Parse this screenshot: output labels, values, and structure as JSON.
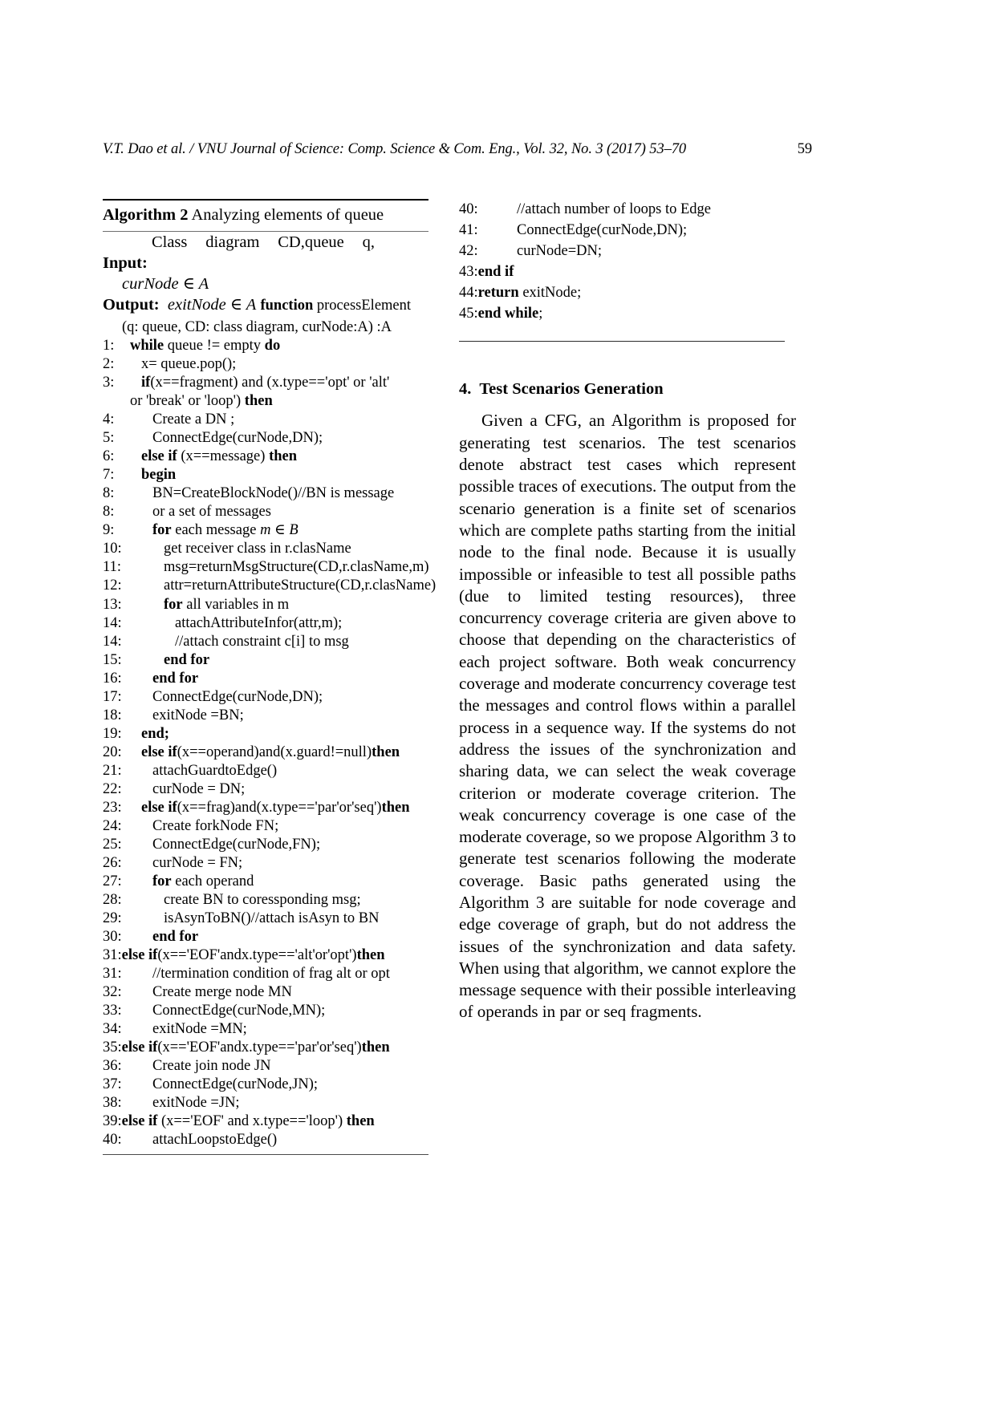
{
  "running_head": {
    "citation": "V.T. Dao et al. / VNU Journal of Science: Comp. Science & Com. Eng., Vol. 32, No. 3 (2017) 53–70",
    "page_number": "59"
  },
  "algorithm": {
    "label": "Algorithm 2",
    "title": "Analyzing elements of queue",
    "input_label": "Input:",
    "input_value_parts": [
      "Class",
      "diagram",
      "CD,queue",
      "q,"
    ],
    "input_value_line2": "curNode ∈ A",
    "output_label": "Output:",
    "output_value": "exitNode ∈ A",
    "output_function_kw": "function",
    "output_function_name": "processElement",
    "signature": "(q: queue, CD: class diagram, curNode:A) :A",
    "lines": [
      {
        "num": "1:",
        "indent": 0,
        "segments": [
          {
            "t": "while ",
            "s": "kw"
          },
          {
            "t": "queue != empty ",
            "s": ""
          },
          {
            "t": "do",
            "s": "kw"
          }
        ]
      },
      {
        "num": "2:",
        "indent": 1,
        "segments": [
          {
            "t": "x= queue.pop();",
            "s": ""
          }
        ]
      },
      {
        "num": "3:",
        "indent": 1,
        "segments": [
          {
            "t": "if",
            "s": "kw"
          },
          {
            "t": "(x==fragment) and (x.type=='opt' or 'alt'",
            "s": ""
          }
        ]
      },
      {
        "num": "",
        "indent": 0,
        "segments": [
          {
            "t": "or 'break' or 'loop') ",
            "s": ""
          },
          {
            "t": "then",
            "s": "kw"
          }
        ]
      },
      {
        "num": "4:",
        "indent": 2,
        "segments": [
          {
            "t": "Create a DN ;",
            "s": ""
          }
        ]
      },
      {
        "num": "5:",
        "indent": 2,
        "segments": [
          {
            "t": "ConnectEdge(curNode,DN);",
            "s": ""
          }
        ]
      },
      {
        "num": "6:",
        "indent": 1,
        "segments": [
          {
            "t": "else if",
            "s": "kw"
          },
          {
            "t": " (x==message) ",
            "s": ""
          },
          {
            "t": "then",
            "s": "kw"
          }
        ]
      },
      {
        "num": "7:",
        "indent": 1,
        "segments": [
          {
            "t": "begin",
            "s": "kw"
          }
        ]
      },
      {
        "num": "8:",
        "indent": 2,
        "segments": [
          {
            "t": "BN=CreateBlockNode()//BN is message",
            "s": ""
          }
        ]
      },
      {
        "num": "8:",
        "indent": 2,
        "segments": [
          {
            "t": "or a set of messages",
            "s": ""
          }
        ]
      },
      {
        "num": "9:",
        "indent": 2,
        "segments": [
          {
            "t": "for",
            "s": "kw"
          },
          {
            "t": " each message ",
            "s": ""
          },
          {
            "t": "m ∈ B",
            "s": "it"
          }
        ]
      },
      {
        "num": "10:",
        "indent": 3,
        "segments": [
          {
            "t": "get receiver class in r.clasName",
            "s": ""
          }
        ]
      },
      {
        "num": "11:",
        "indent": 3,
        "segments": [
          {
            "t": "msg=returnMsgStructure(CD,r.clasName,m)",
            "s": ""
          }
        ]
      },
      {
        "num": "12:",
        "indent": 3,
        "segments": [
          {
            "t": "attr=returnAttributeStructure(CD,r.clasName)",
            "s": ""
          }
        ]
      },
      {
        "num": "13:",
        "indent": 3,
        "segments": [
          {
            "t": "for",
            "s": "kw"
          },
          {
            "t": " all variables in m",
            "s": ""
          }
        ]
      },
      {
        "num": "14:",
        "indent": 4,
        "segments": [
          {
            "t": "attachAttributeInfor(attr,m);",
            "s": ""
          }
        ]
      },
      {
        "num": "14:",
        "indent": 4,
        "segments": [
          {
            "t": "//attach constraint c[i] to msg",
            "s": ""
          }
        ]
      },
      {
        "num": "15:",
        "indent": 3,
        "segments": [
          {
            "t": "end for",
            "s": "kw"
          }
        ]
      },
      {
        "num": "16:",
        "indent": 2,
        "segments": [
          {
            "t": "end for",
            "s": "kw"
          }
        ]
      },
      {
        "num": "17:",
        "indent": 2,
        "segments": [
          {
            "t": "ConnectEdge(curNode,DN);",
            "s": ""
          }
        ]
      },
      {
        "num": "18:",
        "indent": 2,
        "segments": [
          {
            "t": "exitNode =BN;",
            "s": ""
          }
        ]
      },
      {
        "num": "19:",
        "indent": 1,
        "segments": [
          {
            "t": "end;",
            "s": "kw"
          }
        ]
      },
      {
        "num": "20:",
        "indent": 1,
        "segments": [
          {
            "t": "else if",
            "s": "kw"
          },
          {
            "t": "(x==operand)and(x.guard!=null)",
            "s": ""
          },
          {
            "t": "then",
            "s": "kw"
          }
        ]
      },
      {
        "num": "21:",
        "indent": 2,
        "segments": [
          {
            "t": "attachGuardtoEdge()",
            "s": ""
          }
        ]
      },
      {
        "num": "22:",
        "indent": 2,
        "segments": [
          {
            "t": "curNode = DN;",
            "s": ""
          }
        ]
      },
      {
        "num": "23:",
        "indent": 1,
        "segments": [
          {
            "t": "else if",
            "s": "kw"
          },
          {
            "t": "(x==frag)and(x.type=='par'or'seq')",
            "s": ""
          },
          {
            "t": "then",
            "s": "kw"
          }
        ]
      },
      {
        "num": "24:",
        "indent": 2,
        "segments": [
          {
            "t": "Create forkNode FN;",
            "s": ""
          }
        ]
      },
      {
        "num": "25:",
        "indent": 2,
        "segments": [
          {
            "t": "ConnectEdge(curNode,FN);",
            "s": ""
          }
        ]
      },
      {
        "num": "26:",
        "indent": 2,
        "segments": [
          {
            "t": "curNode = FN;",
            "s": ""
          }
        ]
      },
      {
        "num": "27:",
        "indent": 2,
        "segments": [
          {
            "t": "for",
            "s": "kw"
          },
          {
            "t": " each operand",
            "s": ""
          }
        ]
      },
      {
        "num": "28:",
        "indent": 3,
        "segments": [
          {
            "t": "create BN to coressponding msg;",
            "s": ""
          }
        ]
      },
      {
        "num": "29:",
        "indent": 3,
        "segments": [
          {
            "t": "isAsynToBN()//attach isAsyn to BN",
            "s": ""
          }
        ]
      },
      {
        "num": "30:",
        "indent": 2,
        "segments": [
          {
            "t": "end for",
            "s": "kw"
          }
        ]
      },
      {
        "num": "31:",
        "indent": -1,
        "segments": [
          {
            "t": "else if",
            "s": "kw"
          },
          {
            "t": "(x=='EOF'andx.type=='alt'or'opt')",
            "s": ""
          },
          {
            "t": "then",
            "s": "kw"
          }
        ]
      },
      {
        "num": "31:",
        "indent": 2,
        "segments": [
          {
            "t": "//termination condition of frag alt or opt",
            "s": ""
          }
        ]
      },
      {
        "num": "32:",
        "indent": 2,
        "segments": [
          {
            "t": "Create merge node MN",
            "s": ""
          }
        ]
      },
      {
        "num": "33:",
        "indent": 2,
        "segments": [
          {
            "t": "ConnectEdge(curNode,MN);",
            "s": ""
          }
        ]
      },
      {
        "num": "34:",
        "indent": 2,
        "segments": [
          {
            "t": "exitNode =MN;",
            "s": ""
          }
        ]
      },
      {
        "num": "35:",
        "indent": -1,
        "segments": [
          {
            "t": "else if",
            "s": "kw"
          },
          {
            "t": "(x=='EOF'andx.type=='par'or'seq')",
            "s": ""
          },
          {
            "t": "then",
            "s": "kw"
          }
        ]
      },
      {
        "num": "36:",
        "indent": 2,
        "segments": [
          {
            "t": "Create join node JN",
            "s": ""
          }
        ]
      },
      {
        "num": "37:",
        "indent": 2,
        "segments": [
          {
            "t": "ConnectEdge(curNode,JN);",
            "s": ""
          }
        ]
      },
      {
        "num": "38:",
        "indent": 2,
        "segments": [
          {
            "t": "exitNode =JN;",
            "s": ""
          }
        ]
      },
      {
        "num": "39:",
        "indent": -1,
        "segments": [
          {
            "t": "else if",
            "s": "kw"
          },
          {
            "t": " (x=='EOF' and x.type=='loop') ",
            "s": ""
          },
          {
            "t": "then",
            "s": "kw"
          }
        ]
      },
      {
        "num": "40:",
        "indent": 2,
        "segments": [
          {
            "t": "attachLoopstoEdge()",
            "s": ""
          }
        ]
      }
    ],
    "lines_continued": [
      {
        "num": "40:",
        "indent": 2,
        "segments": [
          {
            "t": "//attach number of loops to Edge",
            "s": ""
          }
        ]
      },
      {
        "num": "41:",
        "indent": 2,
        "segments": [
          {
            "t": "ConnectEdge(curNode,DN);",
            "s": ""
          }
        ]
      },
      {
        "num": "42:",
        "indent": 2,
        "segments": [
          {
            "t": "curNode=DN;",
            "s": ""
          }
        ]
      },
      {
        "num": "43:",
        "indent": -1,
        "segments": [
          {
            "t": "end if",
            "s": "kw"
          }
        ]
      },
      {
        "num": "44:",
        "indent": -1,
        "segments": [
          {
            "t": "return",
            "s": "kw"
          },
          {
            "t": " exitNode;",
            "s": ""
          }
        ]
      },
      {
        "num": "45:",
        "indent": -1,
        "segments": [
          {
            "t": "end while",
            "s": "kw"
          },
          {
            "t": ";",
            "s": ""
          }
        ]
      }
    ]
  },
  "section": {
    "number": "4.",
    "title": "Test Scenarios Generation",
    "paragraph": "Given a CFG, an Algorithm is proposed for generating test scenarios.  The test scenarios denote abstract test cases which represent possible traces of executions. The output from the scenario generation is a finite set of scenarios which are complete paths starting from the initial node to the final node.  Because it is usually impossible or infeasible to test all possible paths (due to limited testing resources), three concurrency coverage criteria are given above to choose that depending on the characteristics of each project software.  Both weak concurrency coverage and moderate concurrency coverage test the messages and control flows within a parallel process in a sequence way.  If the systems do not address the issues of the synchronization and sharing data, we can select the weak coverage criterion or moderate coverage criterion.  The weak concurrency coverage is one case of the moderate coverage, so we propose Algorithm 3 to generate test scenarios following the moderate coverage.  Basic paths generated using the Algorithm 3 are suitable for node coverage and edge coverage of graph, but do not address the issues of the synchronization and data safety. When using that algorithm, we cannot explore the message sequence with their possible interleaving of operands in par or seq fragments."
  }
}
